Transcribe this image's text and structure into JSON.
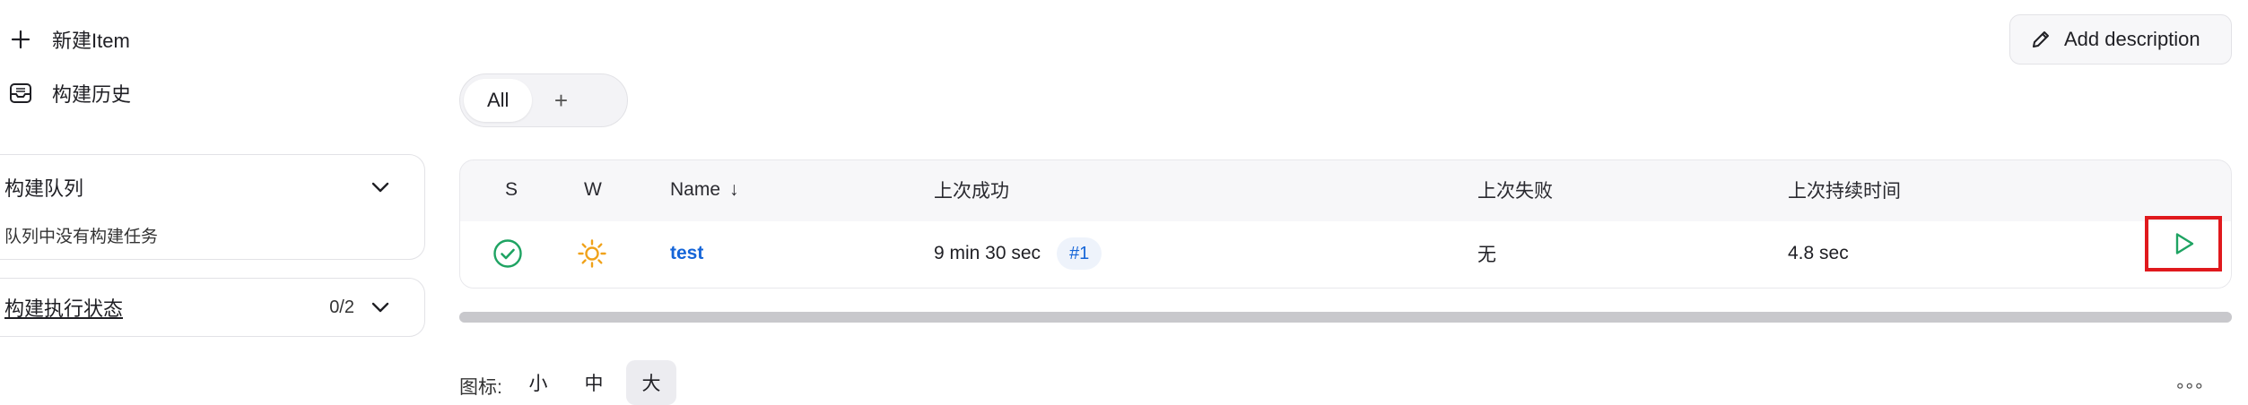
{
  "sidebar": {
    "tasks": [
      {
        "label": "新建Item",
        "icon": "plus-icon"
      },
      {
        "label": "构建历史",
        "icon": "inbox-history-icon"
      }
    ],
    "build_queue": {
      "title": "构建队列",
      "empty_text": "队列中没有构建任务"
    },
    "executor_status": {
      "title": "构建执行状态",
      "count": "0/2"
    }
  },
  "header": {
    "add_description_label": "Add description"
  },
  "views": {
    "tabs": [
      {
        "label": "All"
      }
    ],
    "add_tab_label": "+"
  },
  "table": {
    "columns": [
      "S",
      "W",
      "Name",
      "上次成功",
      "上次失败",
      "上次持续时间"
    ],
    "sort_indicator": "↓",
    "rows": [
      {
        "status_icon": "success-check-icon",
        "weather_icon": "sunny-icon",
        "name": "test",
        "last_success": "9 min 30 sec",
        "last_success_build": "#1",
        "last_failure": "无",
        "last_duration": "4.8 sec",
        "action_icon": "play-icon"
      }
    ]
  },
  "footer": {
    "icon_size_label": "图标:",
    "sizes": [
      "小",
      "中",
      "大"
    ],
    "active_size": "大",
    "more_label": "∘∘∘"
  },
  "colors": {
    "success": "#1ea362",
    "link": "#1565d8",
    "highlight": "#e0191d",
    "weather": "#f0a21a"
  }
}
